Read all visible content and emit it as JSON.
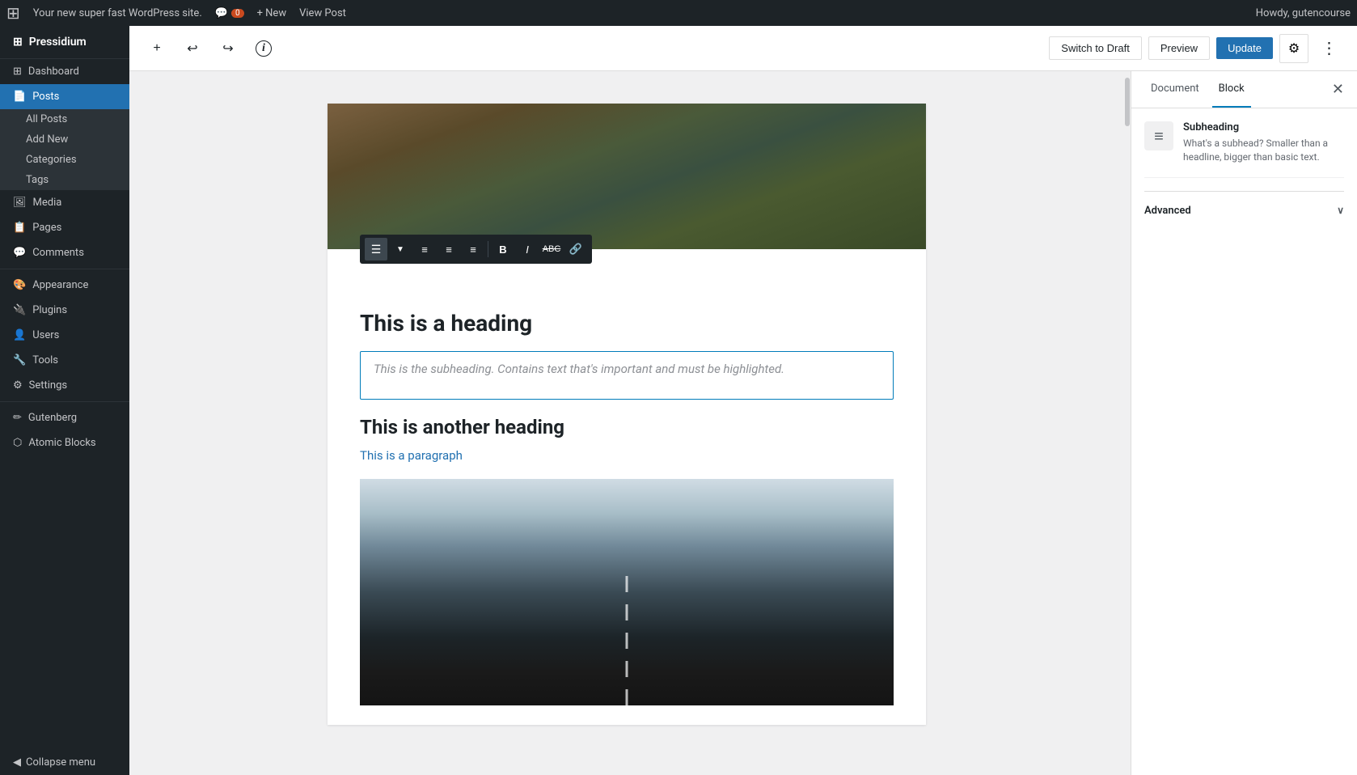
{
  "adminBar": {
    "wpIcon": "⊞",
    "siteName": "Your new super fast WordPress site.",
    "commentsIcon": "💬",
    "commentCount": "0",
    "newLabel": "+ New",
    "viewPostLabel": "View Post",
    "howdyLabel": "Howdy, gutencourse"
  },
  "sidebar": {
    "brandName": "Pressidium",
    "items": [
      {
        "id": "dashboard",
        "label": "Dashboard",
        "icon": "⊞"
      },
      {
        "id": "posts",
        "label": "Posts",
        "icon": "📄",
        "active": true
      },
      {
        "id": "media",
        "label": "Media",
        "icon": "🖼"
      },
      {
        "id": "pages",
        "label": "Pages",
        "icon": "📋"
      },
      {
        "id": "comments",
        "label": "Comments",
        "icon": "💬"
      },
      {
        "id": "appearance",
        "label": "Appearance",
        "icon": "🎨"
      },
      {
        "id": "plugins",
        "label": "Plugins",
        "icon": "🔌"
      },
      {
        "id": "users",
        "label": "Users",
        "icon": "👤"
      },
      {
        "id": "tools",
        "label": "Tools",
        "icon": "🔧"
      },
      {
        "id": "settings",
        "label": "Settings",
        "icon": "⚙"
      },
      {
        "id": "gutenberg",
        "label": "Gutenberg",
        "icon": "✏"
      },
      {
        "id": "atomic-blocks",
        "label": "Atomic Blocks",
        "icon": "⬡"
      }
    ],
    "postsSubItems": [
      {
        "id": "all-posts",
        "label": "All Posts"
      },
      {
        "id": "add-new",
        "label": "Add New"
      },
      {
        "id": "categories",
        "label": "Categories"
      },
      {
        "id": "tags",
        "label": "Tags"
      }
    ],
    "collapseLabel": "Collapse menu"
  },
  "toolbar": {
    "addBlockTitle": "+",
    "undoTitle": "↩",
    "redoTitle": "↪",
    "infoTitle": "ℹ",
    "switchToDraftLabel": "Switch to Draft",
    "previewLabel": "Preview",
    "updateLabel": "Update",
    "settingsTitle": "⚙"
  },
  "formattingToolbar": {
    "alignLeftIcon": "≡",
    "alignCenterIcon": "≡",
    "alignRightIcon": "≡",
    "alignJustifyIcon": "≡",
    "boldIcon": "B",
    "italicIcon": "I",
    "strikethroughIcon": "ABC",
    "linkIcon": "🔗"
  },
  "post": {
    "heading1": "This is a heading",
    "subheadingPlaceholder": "This is the subheading. Contains text that's important and must be highlighted.",
    "heading2": "This is another heading",
    "paragraph": "This is a paragraph"
  },
  "rightPanel": {
    "documentTabLabel": "Document",
    "blockTabLabel": "Block",
    "closeIcon": "✕",
    "blockInfo": {
      "iconSymbol": "≡",
      "title": "Subheading",
      "description": "What's a subhead? Smaller than a headline, bigger than basic text."
    },
    "advancedSectionLabel": "Advanced",
    "chevronIcon": "∨"
  }
}
